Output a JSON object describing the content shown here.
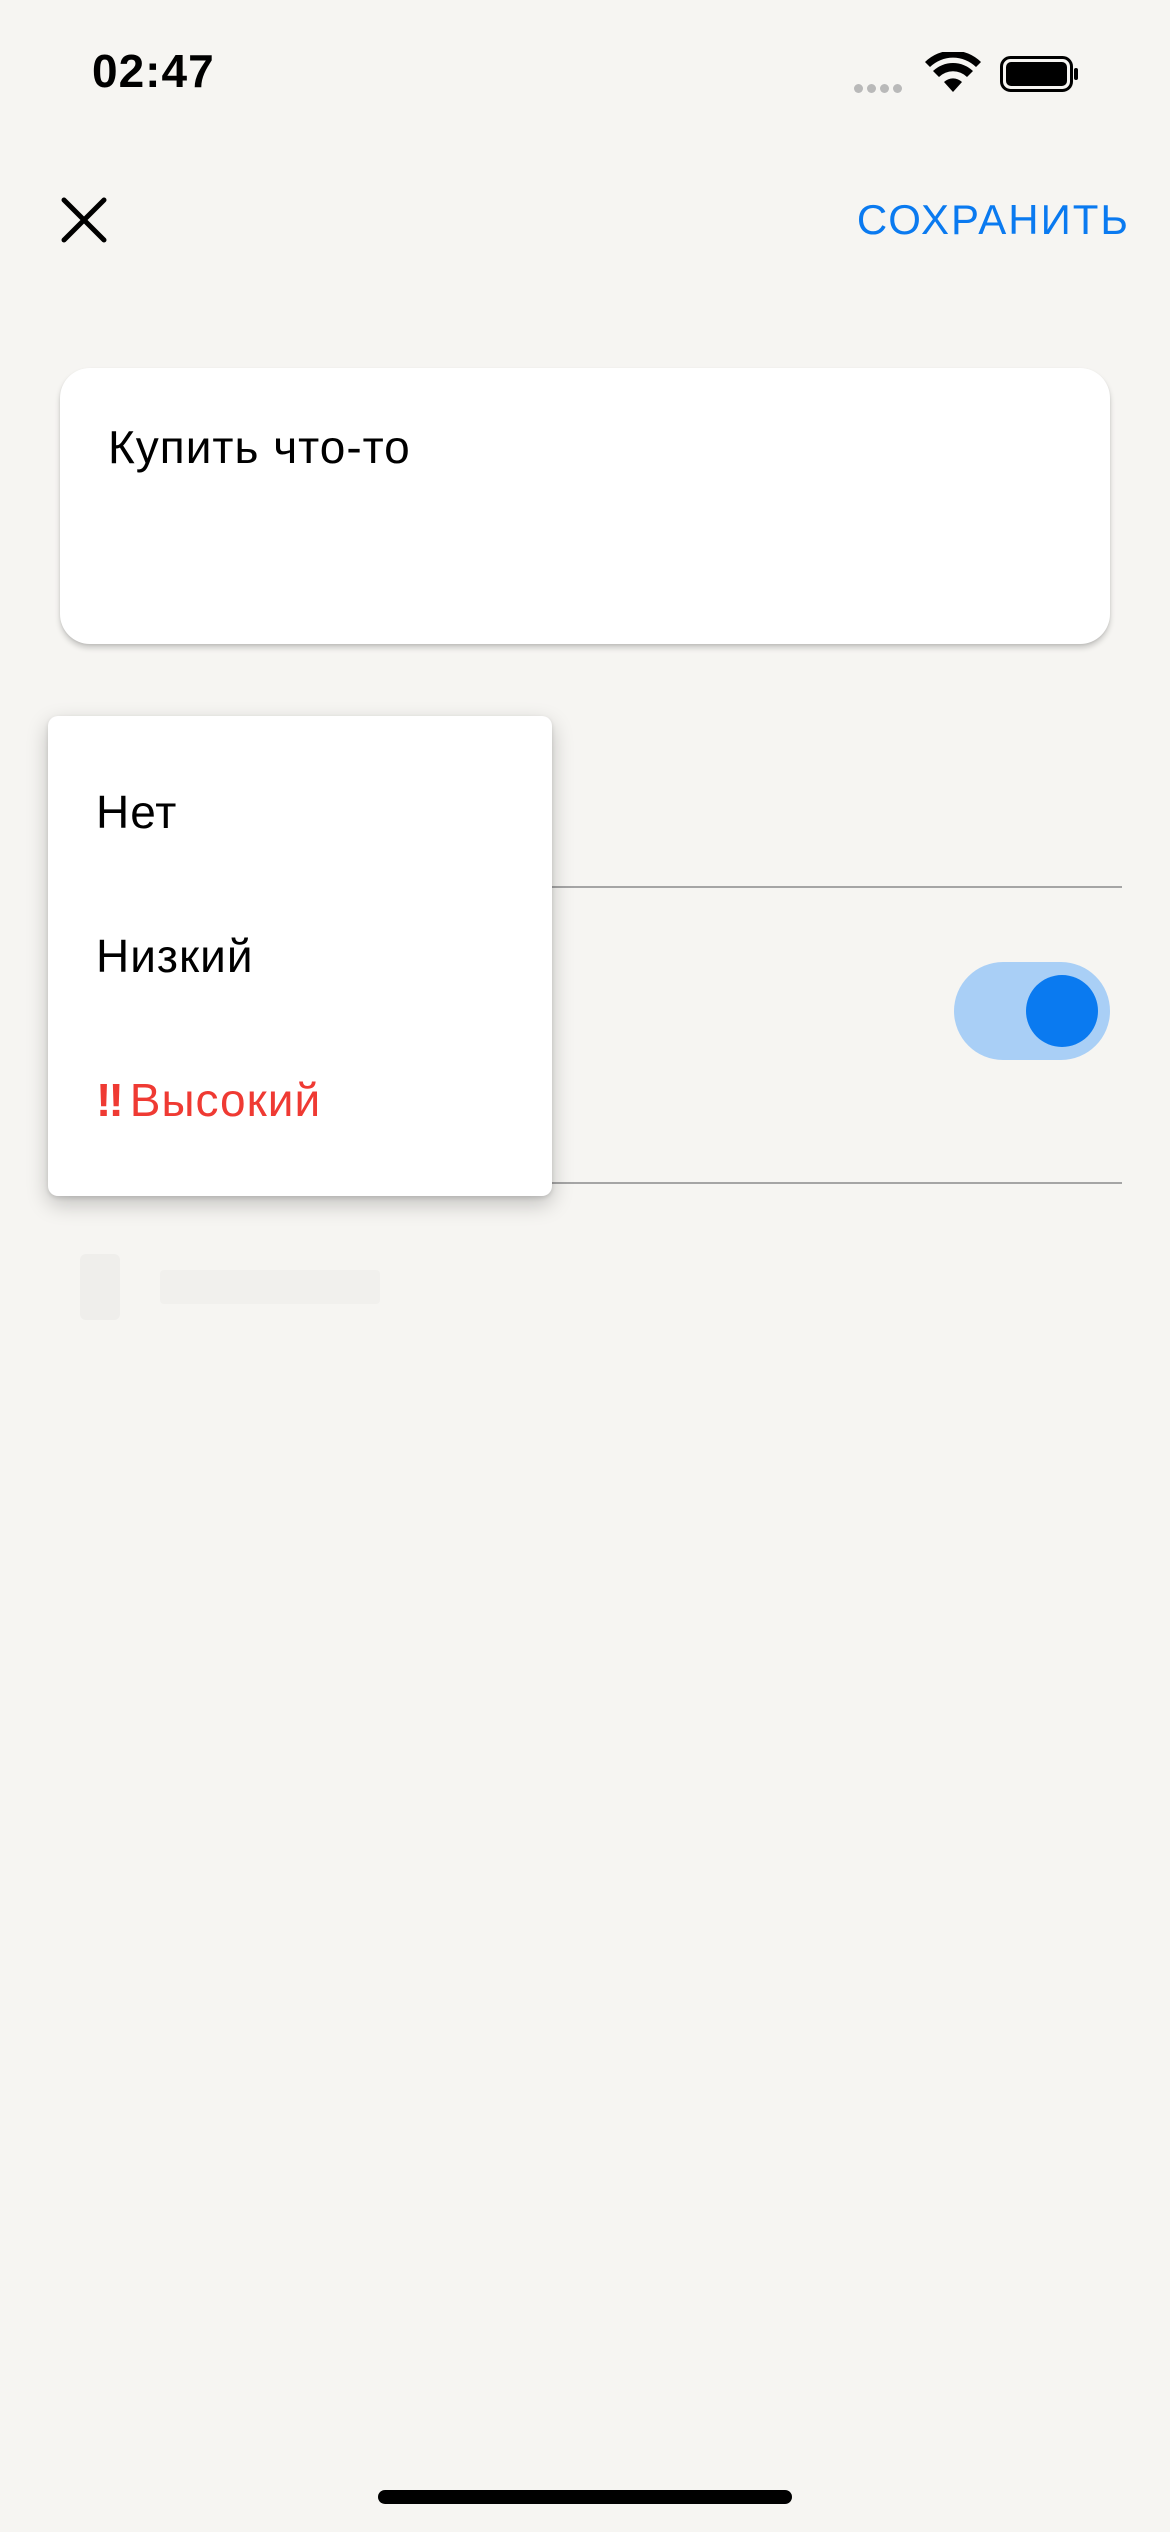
{
  "status_bar": {
    "time": "02:47",
    "icons": [
      "signal-icon",
      "wifi-icon",
      "battery-icon"
    ]
  },
  "toolbar": {
    "close_icon": "close-icon",
    "save_label": "СОХРАНИТЬ"
  },
  "task": {
    "text": "Купить что-то"
  },
  "priority_menu": {
    "items": [
      {
        "label": "Нет"
      },
      {
        "label": "Низкий"
      },
      {
        "prefix": "‼",
        "label": "Высокий"
      }
    ]
  },
  "deadline_toggle": {
    "state": "on"
  },
  "colors": {
    "accent": "#0a7af0",
    "accent_light": "#a9cff6",
    "high_priority": "#ef3a33",
    "background": "#f6f5f2"
  }
}
